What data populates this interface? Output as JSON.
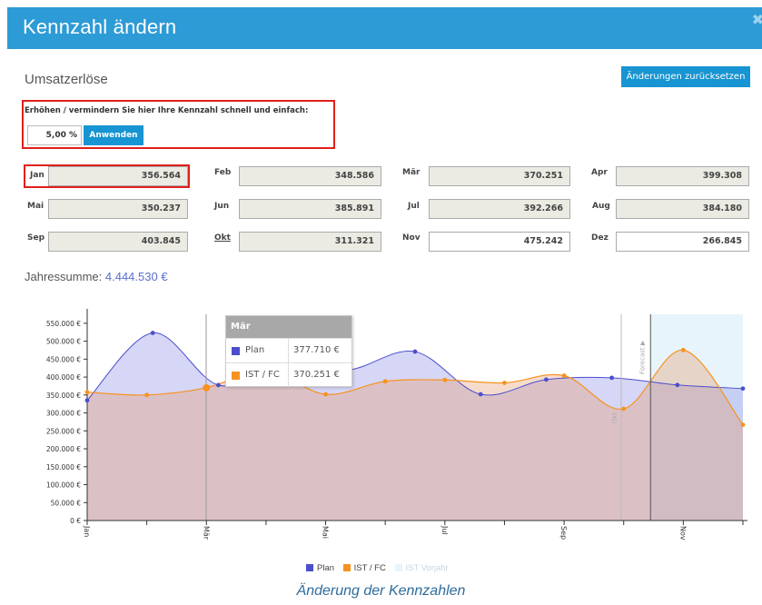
{
  "dialog": {
    "title": "Kennzahl ändern",
    "close_icon": "close-icon",
    "section_title": "Umsatzerlöse",
    "reset_label": "Änderungen zurücksetzen"
  },
  "adjust": {
    "label": "Erhöhen / vermindern Sie hier Ihre Kennzahl schnell und einfach:",
    "percent_value": "5,00 %",
    "apply_label": "Anwenden"
  },
  "months": [
    {
      "label": "Jan",
      "value": "356.564"
    },
    {
      "label": "Feb",
      "value": "348.586"
    },
    {
      "label": "Mär",
      "value": "370.251"
    },
    {
      "label": "Apr",
      "value": "399.308"
    },
    {
      "label": "Mai",
      "value": "350.237"
    },
    {
      "label": "Jun",
      "value": "385.891"
    },
    {
      "label": "Jul",
      "value": "392.266"
    },
    {
      "label": "Aug",
      "value": "384.180"
    },
    {
      "label": "Sep",
      "value": "403.845"
    },
    {
      "label": "Okt",
      "value": "311.321"
    },
    {
      "label": "Nov",
      "value": "475.242"
    },
    {
      "label": "Dez",
      "value": "266.845"
    }
  ],
  "summary": {
    "label": "Jahressumme: ",
    "value": "4.444.530 €"
  },
  "tooltip": {
    "header": "Mär",
    "rows": [
      {
        "name": "Plan",
        "value": "377.710 €"
      },
      {
        "name": "IST / FC",
        "value": "370.251 €"
      }
    ]
  },
  "legend": [
    {
      "name": "Plan"
    },
    {
      "name": "IST / FC"
    },
    {
      "name": "IST Vorjahr"
    }
  ],
  "caption": "Änderung der Kennzahlen",
  "colors": {
    "header": "#2d9bd6",
    "button": "#1794d2",
    "highlight": "#e0201a",
    "plan": "#4b4fcc",
    "ist": "#f7921e",
    "vorjahr": "#e7f4fb"
  },
  "chart_data": {
    "type": "area",
    "x": [
      "Jan",
      "Feb",
      "Mär",
      "Apr",
      "Mai",
      "Jun",
      "Jul",
      "Aug",
      "Sep",
      "Okt",
      "Nov",
      "Dez"
    ],
    "x_tick_labels": [
      "Jan",
      "Mär",
      "Mai",
      "Jul",
      "Sep",
      "Nov"
    ],
    "y_ticks": [
      "0 €",
      "50.000 €",
      "100.000 €",
      "150.000 €",
      "200.000 €",
      "250.000 €",
      "300.000 €",
      "350.000 €",
      "400.000 €",
      "450.000 €",
      "500.000 €",
      "550.000 €"
    ],
    "ylim": [
      0,
      575000
    ],
    "series": [
      {
        "name": "Plan",
        "values": [
          335000,
          523000,
          377710,
          422000,
          420000,
          471000,
          352000,
          393000,
          398000,
          378000,
          368000
        ]
      },
      {
        "name": "IST / FC",
        "values": [
          358000,
          350000,
          370251,
          418000,
          352000,
          388000,
          392000,
          384000,
          404000,
          311321,
          475242,
          266845
        ]
      }
    ],
    "annotations": [
      "Forecast ▶",
      "Okt"
    ],
    "legend_position": "bottom"
  }
}
